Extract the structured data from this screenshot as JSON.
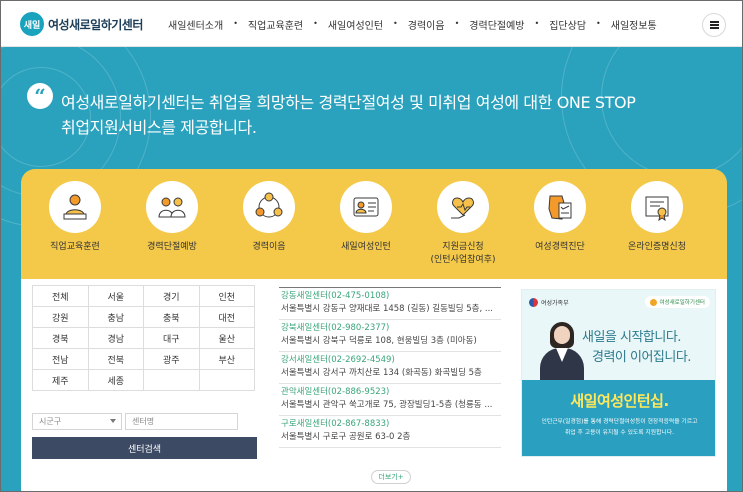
{
  "brand": {
    "logo_mark": "새일",
    "name": "여성새로일하기센터"
  },
  "nav": {
    "items": [
      "새일센터소개",
      "직업교육훈련",
      "새일여성인턴",
      "경력이음",
      "경력단절예방",
      "집단상담",
      "새일정보통"
    ],
    "separator": "•",
    "menu_icon": "hamburger-icon"
  },
  "hero": {
    "quote_mark": "“",
    "headline_line1": "여성새로일하기센터는 취업을 희망하는 경력단절여성 및 미취업 여성에 대한 ONE STOP",
    "headline_line2": "취업지원서비스를 제공합니다.",
    "bg_color": "#2aa2bd"
  },
  "services": {
    "accent": "#f4c94a",
    "items": [
      {
        "label": "직업교육훈련",
        "icon": "teacher-icon"
      },
      {
        "label": "경력단절예방",
        "icon": "people-icon"
      },
      {
        "label": "경력이음",
        "icon": "network-icon"
      },
      {
        "label": "새일여성인턴",
        "icon": "id-card-icon"
      },
      {
        "label": "지원금신청",
        "label2": "(인턴사업참여후)",
        "icon": "heart-hand-icon"
      },
      {
        "label": "여성경력진단",
        "icon": "checklist-map-icon"
      },
      {
        "label": "온라인증명신청",
        "icon": "certificate-icon"
      }
    ]
  },
  "regions": {
    "cells": [
      "전체",
      "서울",
      "경기",
      "인천",
      "강원",
      "충남",
      "충북",
      "대전",
      "경북",
      "경남",
      "대구",
      "울산",
      "전남",
      "전북",
      "광주",
      "부산",
      "제주",
      "세종"
    ]
  },
  "filters": {
    "district_placeholder": "시군구",
    "center_placeholder": "센터명",
    "search_label": "센터검색"
  },
  "centers": {
    "items": [
      {
        "name": "강동새일센터(02-475-0108)",
        "address": "서울특별시 강동구 양재대로 1458 (길동) 길동빌딩 5층, ..."
      },
      {
        "name": "강북새일센터(02-980-2377)",
        "address": "서울특별시 강북구 덕릉로 108, 현웅빌딩 3층 (미아동)"
      },
      {
        "name": "강서새일센터(02-2692-4549)",
        "address": "서울특별시 강서구 까치산로 134 (화곡동) 화곡빌딩 5층"
      },
      {
        "name": "관악새일센터(02-886-9523)",
        "address": "서울특별시 관악구 쑥고개로 75, 광장빌딩1-5층 (청룡동 ..."
      },
      {
        "name": "구로새일센터(02-867-8833)",
        "address": "서울특별시 구로구 공원로 63-0 2층"
      }
    ],
    "more_label": "더보기+"
  },
  "banner": {
    "ministry": "여성가족부",
    "brand": "여성새로일하기센터",
    "slogan1": "새일을 시작합니다.",
    "slogan2": "경력이 이어집니다.",
    "title": "새일여성인턴십.",
    "desc_line1": "인턴근무(일경험)를 통해 경력단절여성등이 현장적응력을 기르고",
    "desc_line2": "취업 후 고용이 유지될 수 있도록 지원합니다.",
    "controls": "‹ ॥ ›"
  }
}
